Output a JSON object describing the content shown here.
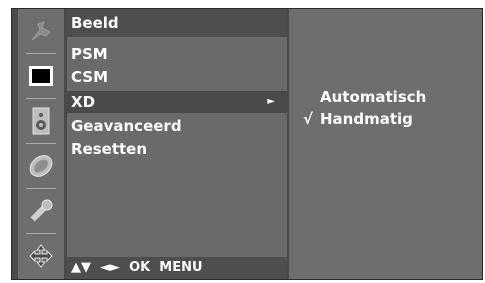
{
  "menu": {
    "title": "Beeld",
    "items": [
      {
        "label": "PSM"
      },
      {
        "label": "CSM"
      },
      {
        "label": "XD",
        "arrow": "►",
        "selected": true
      },
      {
        "label": "Geavanceerd"
      },
      {
        "label": "Resetten"
      }
    ],
    "nav_hint": "▲▼  ◄►  OK  MENU"
  },
  "submenu": {
    "options": [
      {
        "label": "Automatisch",
        "check": ""
      },
      {
        "label": "Handmatig",
        "check": "√"
      }
    ]
  },
  "sidebar": {
    "icons": [
      "setup-icon",
      "picture-icon",
      "audio-icon",
      "time-icon",
      "option-icon",
      "input-icon"
    ],
    "active_icon": "picture-icon"
  }
}
